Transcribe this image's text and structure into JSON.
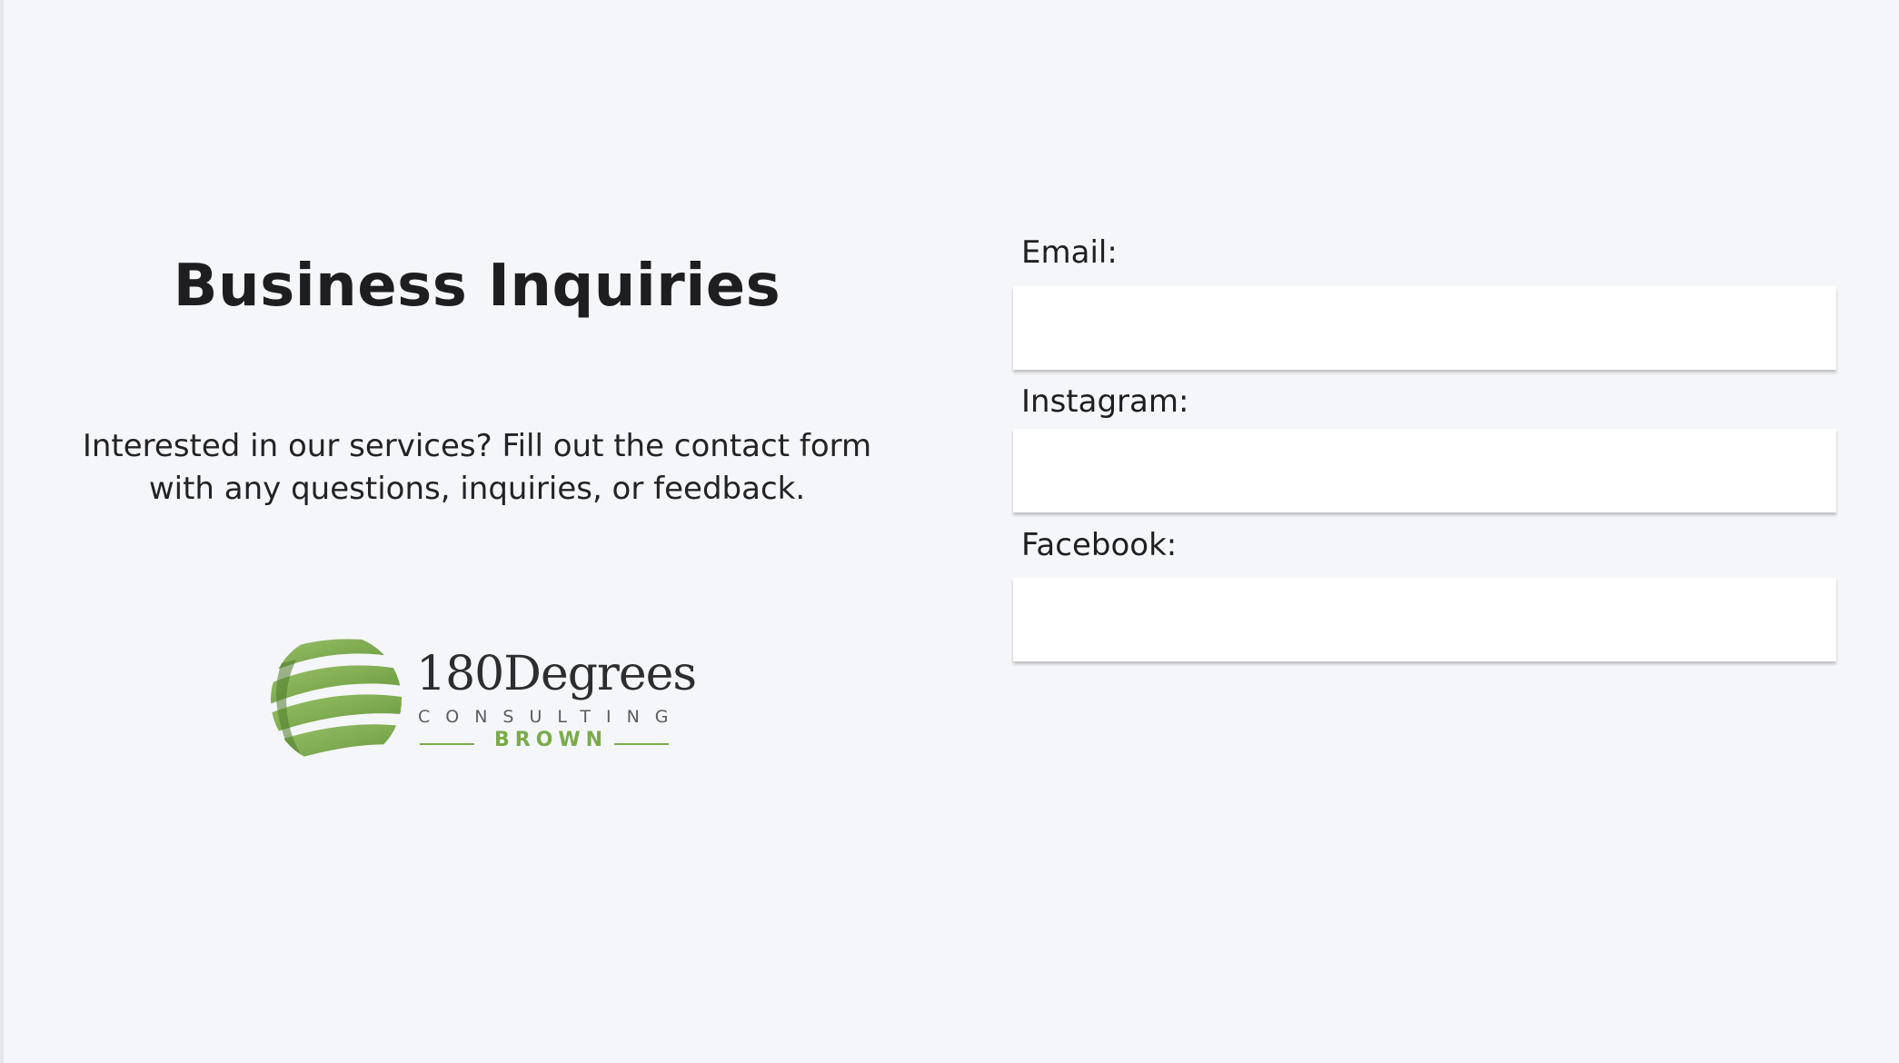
{
  "page": {
    "title": "Business Inquiries",
    "intro_line1": "Interested in our services? Fill out the contact form",
    "intro_line2": "with any questions, inquiries, or feedback."
  },
  "logo": {
    "wordmark": "180Degrees",
    "subtitle": "CONSULTING",
    "chapter": "BROWN",
    "accent_color": "#7aab4a"
  },
  "form": {
    "fields": [
      {
        "label": "Email:",
        "value": "",
        "placeholder": ""
      },
      {
        "label": "Instagram:",
        "value": "",
        "placeholder": ""
      },
      {
        "label": "Facebook:",
        "value": "",
        "placeholder": ""
      }
    ]
  },
  "colors": {
    "background": "#f5f6f9",
    "text": "#1f1f22",
    "input_background": "#ffffff"
  }
}
